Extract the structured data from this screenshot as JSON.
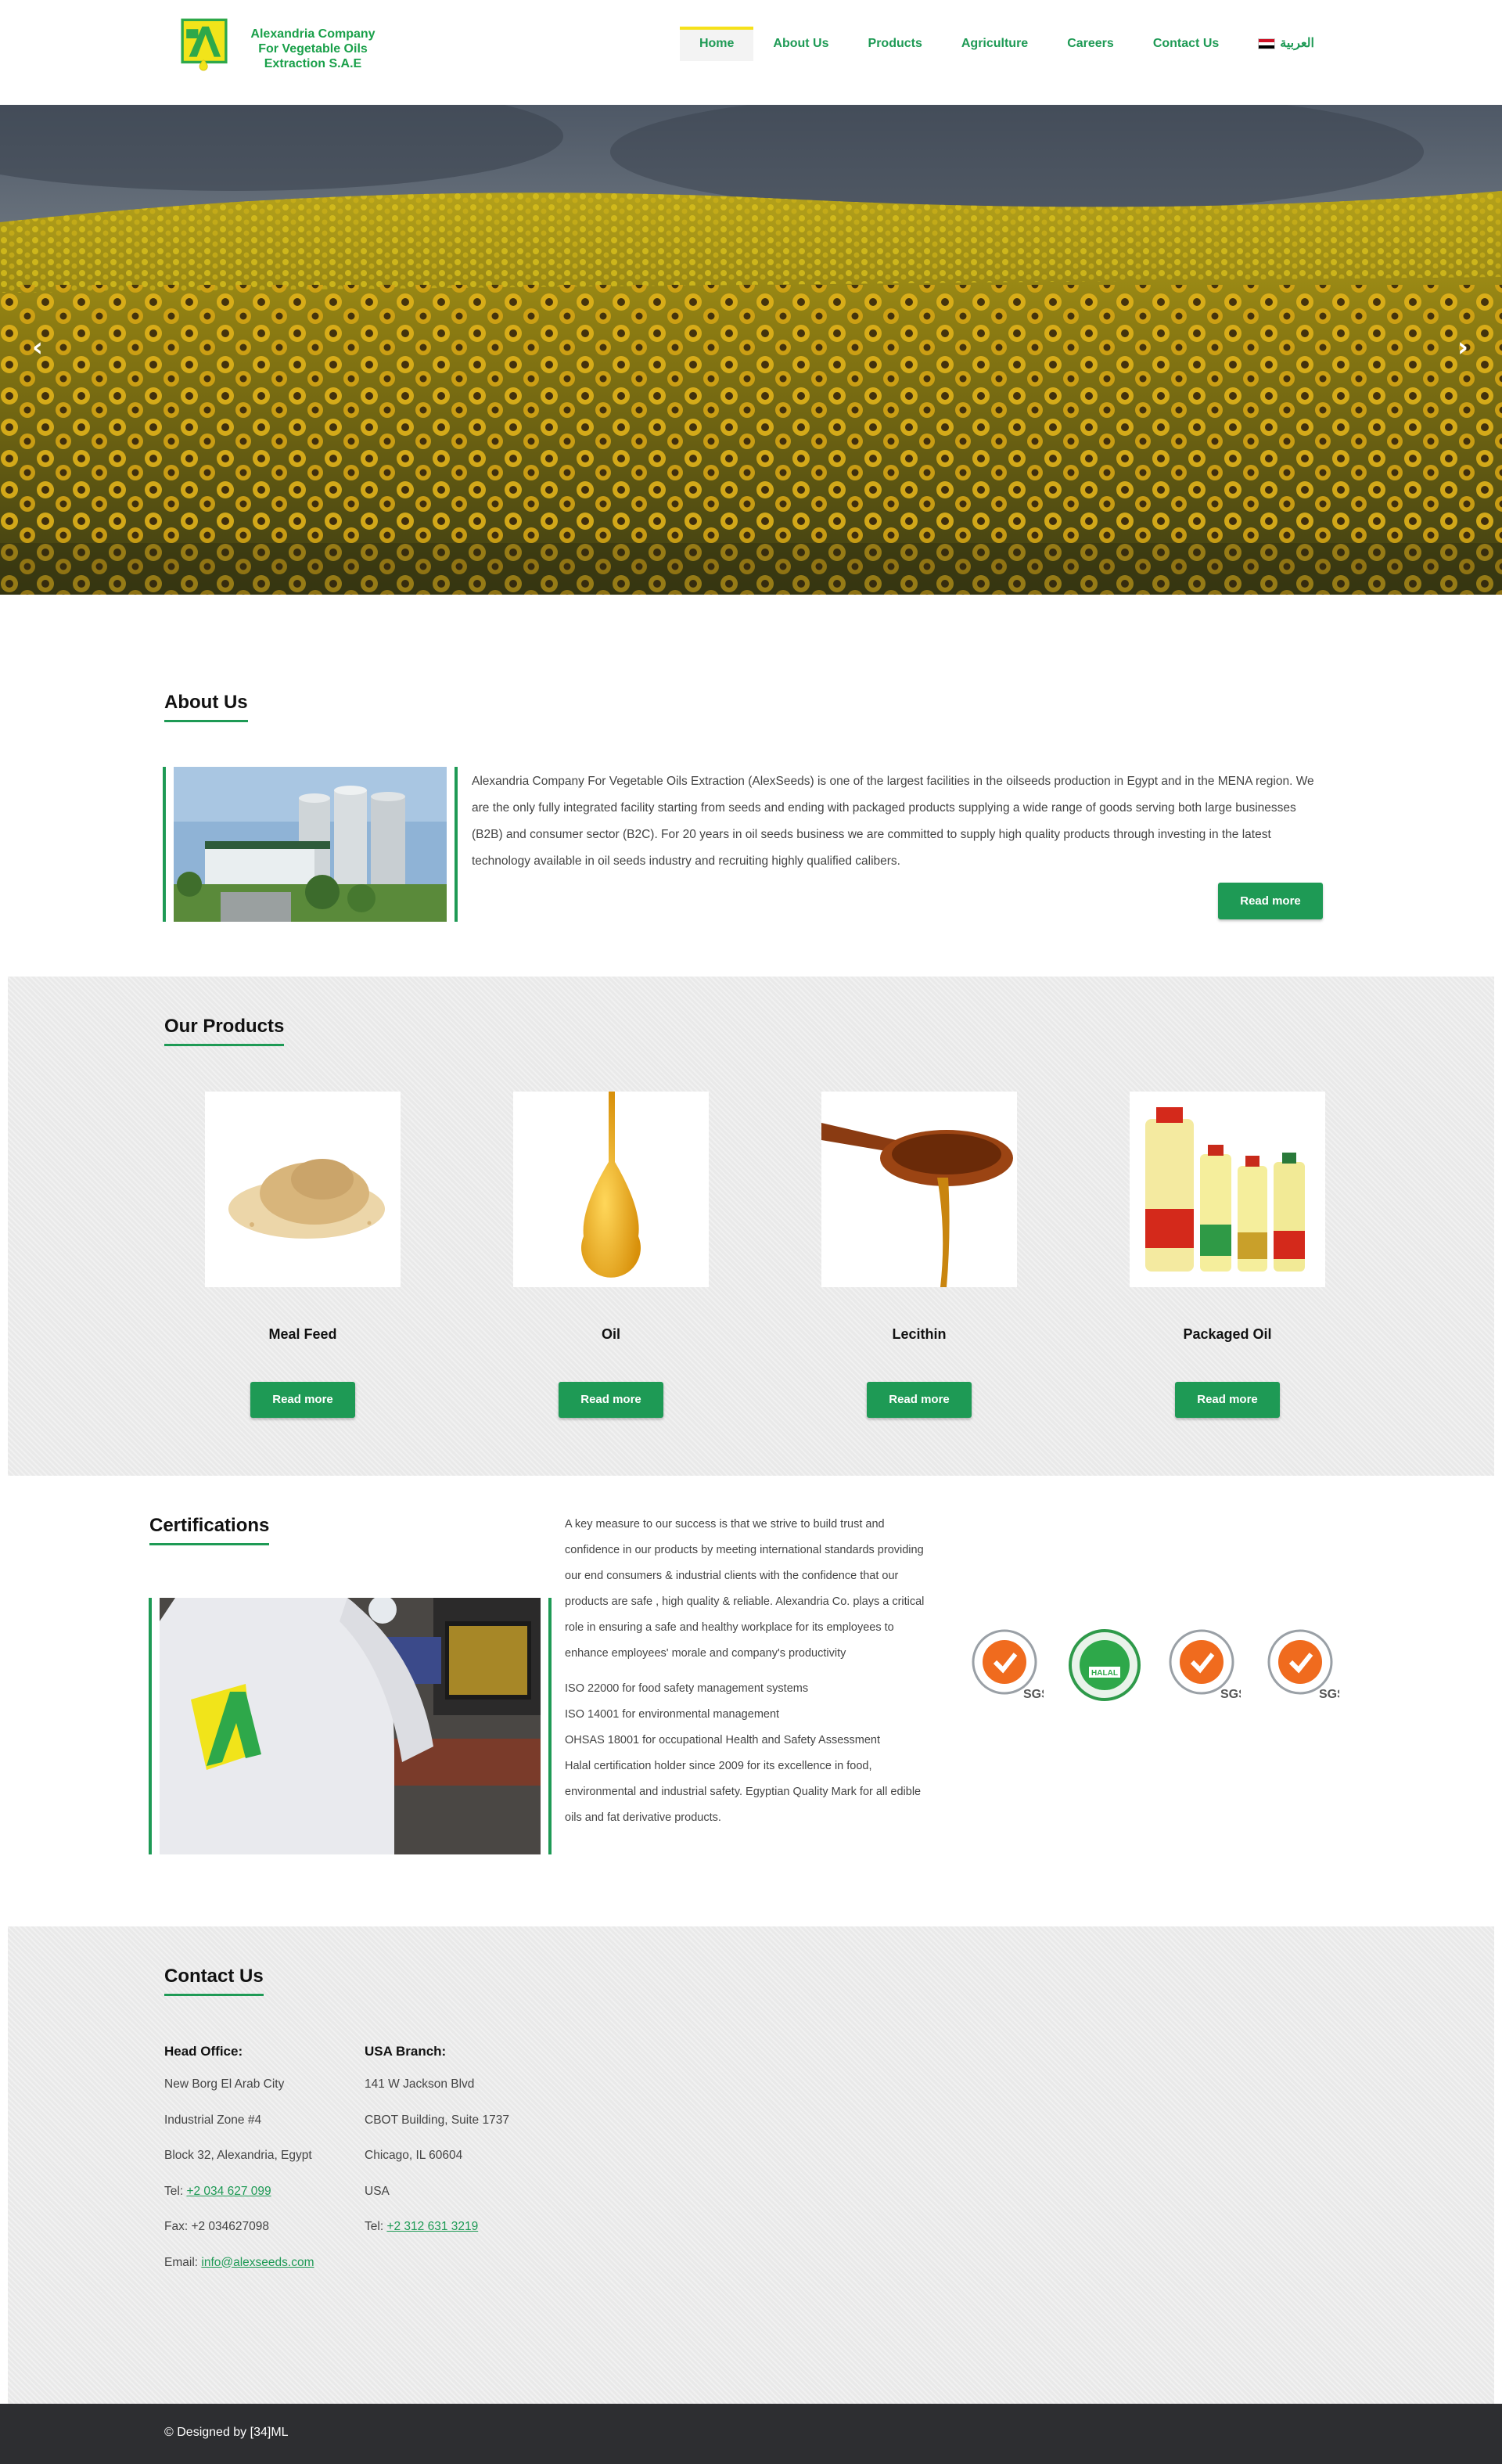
{
  "header": {
    "logo_text": "Alexandria Company For Vegetable Oils Extraction S.A.E",
    "nav": [
      "Home",
      "About Us",
      "Products",
      "Agriculture",
      "Careers",
      "Contact Us",
      "العربية"
    ]
  },
  "about": {
    "title": "About Us",
    "text": "Alexandria Company For Vegetable Oils Extraction (AlexSeeds) is one of the largest facilities in the oilseeds production in Egypt and in the MENA region. We are the only fully integrated facility starting from seeds and ending with packaged products supplying a wide range of goods serving both large businesses (B2B) and consumer sector (B2C). For 20 years in oil seeds business we are committed to supply high quality products through investing in the latest technology available in oil seeds industry and recruiting highly qualified calibers.",
    "button": "Read more"
  },
  "products": {
    "title": "Our Products",
    "items": [
      {
        "name": "Meal Feed",
        "button": "Read more"
      },
      {
        "name": "Oil",
        "button": "Read more"
      },
      {
        "name": "Lecithin",
        "button": "Read more"
      },
      {
        "name": "Packaged Oil",
        "button": "Read more"
      }
    ]
  },
  "certifications": {
    "title": "Certifications",
    "intro": "A key measure to our success is that we strive to  build trust and confidence in our products by meeting  international standards providing our end consumers & industrial clients with the confidence that our products are safe , high quality & reliable. Alexandria Co. plays a critical role in ensuring a safe and healthy workplace for its employees to enhance employees' morale and company's productivity",
    "list": [
      "ISO 22000 for food safety management systems",
      "ISO 14001 for environmental management",
      "OHSAS 18001 for occupational Health and Safety Assessment",
      "Halal certification holder since 2009 for its excellence in food, environmental and industrial safety. Egyptian Quality Mark for all edible oils and fat derivative products."
    ],
    "badge_label": "SGS",
    "halal_label": "HALAL"
  },
  "contact": {
    "title": "Contact Us",
    "head_office": {
      "heading": "Head Office:",
      "lines": [
        "New Borg El Arab City",
        "Industrial Zone #4",
        "Block 32, Alexandria, Egypt"
      ],
      "tel_label": "Tel: ",
      "tel": "+2 034 627 099",
      "fax": "Fax: +2 034627098",
      "email_label": "Email: ",
      "email": "info@alexseeds.com"
    },
    "usa_branch": {
      "heading": "USA Branch:",
      "lines": [
        "141 W Jackson Blvd",
        "CBOT Building, Suite 1737",
        "Chicago, IL 60604",
        "USA"
      ],
      "tel_label": "Tel: ",
      "tel": "+2 312 631 3219"
    }
  },
  "footer": {
    "text": "© Designed by [34]ML"
  },
  "colors": {
    "accent": "#1e9a55",
    "nav_active_bar": "#f6e11a",
    "footer_bg": "#2d2e31"
  }
}
